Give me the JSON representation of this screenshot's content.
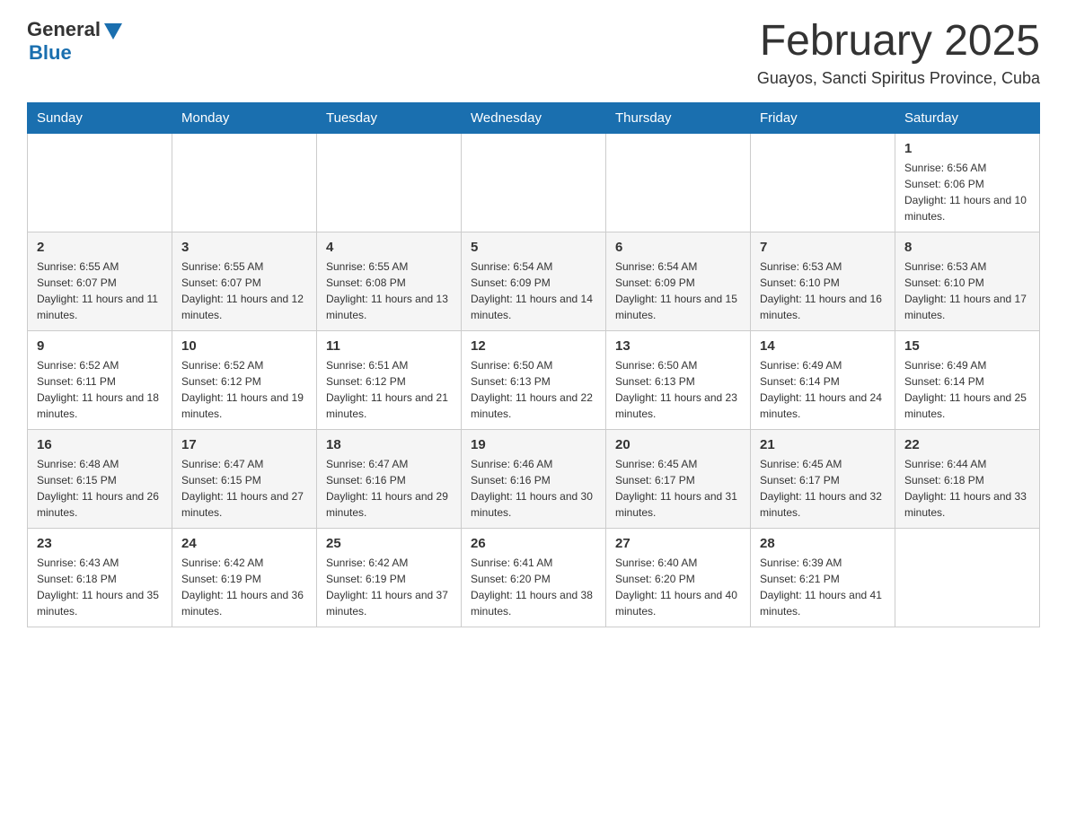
{
  "logo": {
    "general": "General",
    "blue": "Blue"
  },
  "title": "February 2025",
  "location": "Guayos, Sancti Spiritus Province, Cuba",
  "days_of_week": [
    "Sunday",
    "Monday",
    "Tuesday",
    "Wednesday",
    "Thursday",
    "Friday",
    "Saturday"
  ],
  "weeks": [
    [
      {
        "day": "",
        "info": ""
      },
      {
        "day": "",
        "info": ""
      },
      {
        "day": "",
        "info": ""
      },
      {
        "day": "",
        "info": ""
      },
      {
        "day": "",
        "info": ""
      },
      {
        "day": "",
        "info": ""
      },
      {
        "day": "1",
        "info": "Sunrise: 6:56 AM\nSunset: 6:06 PM\nDaylight: 11 hours and 10 minutes."
      }
    ],
    [
      {
        "day": "2",
        "info": "Sunrise: 6:55 AM\nSunset: 6:07 PM\nDaylight: 11 hours and 11 minutes."
      },
      {
        "day": "3",
        "info": "Sunrise: 6:55 AM\nSunset: 6:07 PM\nDaylight: 11 hours and 12 minutes."
      },
      {
        "day": "4",
        "info": "Sunrise: 6:55 AM\nSunset: 6:08 PM\nDaylight: 11 hours and 13 minutes."
      },
      {
        "day": "5",
        "info": "Sunrise: 6:54 AM\nSunset: 6:09 PM\nDaylight: 11 hours and 14 minutes."
      },
      {
        "day": "6",
        "info": "Sunrise: 6:54 AM\nSunset: 6:09 PM\nDaylight: 11 hours and 15 minutes."
      },
      {
        "day": "7",
        "info": "Sunrise: 6:53 AM\nSunset: 6:10 PM\nDaylight: 11 hours and 16 minutes."
      },
      {
        "day": "8",
        "info": "Sunrise: 6:53 AM\nSunset: 6:10 PM\nDaylight: 11 hours and 17 minutes."
      }
    ],
    [
      {
        "day": "9",
        "info": "Sunrise: 6:52 AM\nSunset: 6:11 PM\nDaylight: 11 hours and 18 minutes."
      },
      {
        "day": "10",
        "info": "Sunrise: 6:52 AM\nSunset: 6:12 PM\nDaylight: 11 hours and 19 minutes."
      },
      {
        "day": "11",
        "info": "Sunrise: 6:51 AM\nSunset: 6:12 PM\nDaylight: 11 hours and 21 minutes."
      },
      {
        "day": "12",
        "info": "Sunrise: 6:50 AM\nSunset: 6:13 PM\nDaylight: 11 hours and 22 minutes."
      },
      {
        "day": "13",
        "info": "Sunrise: 6:50 AM\nSunset: 6:13 PM\nDaylight: 11 hours and 23 minutes."
      },
      {
        "day": "14",
        "info": "Sunrise: 6:49 AM\nSunset: 6:14 PM\nDaylight: 11 hours and 24 minutes."
      },
      {
        "day": "15",
        "info": "Sunrise: 6:49 AM\nSunset: 6:14 PM\nDaylight: 11 hours and 25 minutes."
      }
    ],
    [
      {
        "day": "16",
        "info": "Sunrise: 6:48 AM\nSunset: 6:15 PM\nDaylight: 11 hours and 26 minutes."
      },
      {
        "day": "17",
        "info": "Sunrise: 6:47 AM\nSunset: 6:15 PM\nDaylight: 11 hours and 27 minutes."
      },
      {
        "day": "18",
        "info": "Sunrise: 6:47 AM\nSunset: 6:16 PM\nDaylight: 11 hours and 29 minutes."
      },
      {
        "day": "19",
        "info": "Sunrise: 6:46 AM\nSunset: 6:16 PM\nDaylight: 11 hours and 30 minutes."
      },
      {
        "day": "20",
        "info": "Sunrise: 6:45 AM\nSunset: 6:17 PM\nDaylight: 11 hours and 31 minutes."
      },
      {
        "day": "21",
        "info": "Sunrise: 6:45 AM\nSunset: 6:17 PM\nDaylight: 11 hours and 32 minutes."
      },
      {
        "day": "22",
        "info": "Sunrise: 6:44 AM\nSunset: 6:18 PM\nDaylight: 11 hours and 33 minutes."
      }
    ],
    [
      {
        "day": "23",
        "info": "Sunrise: 6:43 AM\nSunset: 6:18 PM\nDaylight: 11 hours and 35 minutes."
      },
      {
        "day": "24",
        "info": "Sunrise: 6:42 AM\nSunset: 6:19 PM\nDaylight: 11 hours and 36 minutes."
      },
      {
        "day": "25",
        "info": "Sunrise: 6:42 AM\nSunset: 6:19 PM\nDaylight: 11 hours and 37 minutes."
      },
      {
        "day": "26",
        "info": "Sunrise: 6:41 AM\nSunset: 6:20 PM\nDaylight: 11 hours and 38 minutes."
      },
      {
        "day": "27",
        "info": "Sunrise: 6:40 AM\nSunset: 6:20 PM\nDaylight: 11 hours and 40 minutes."
      },
      {
        "day": "28",
        "info": "Sunrise: 6:39 AM\nSunset: 6:21 PM\nDaylight: 11 hours and 41 minutes."
      },
      {
        "day": "",
        "info": ""
      }
    ]
  ]
}
